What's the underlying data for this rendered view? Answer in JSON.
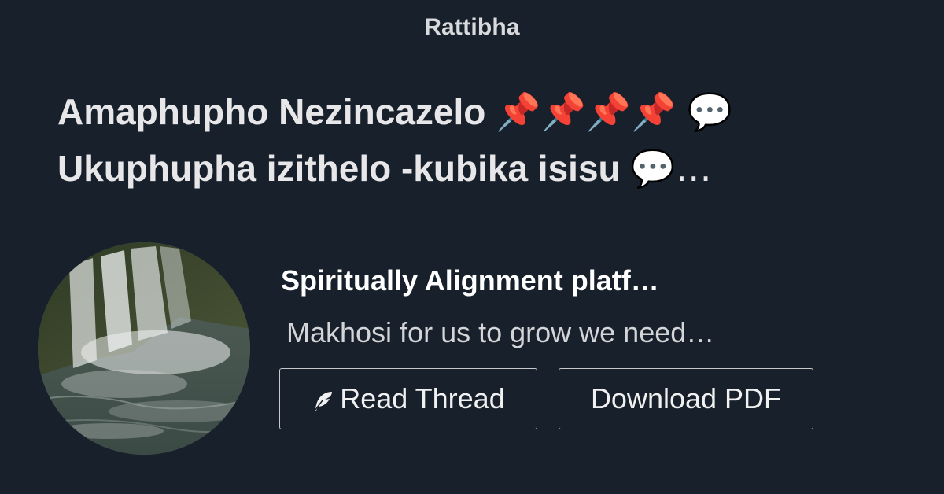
{
  "brand": {
    "name": "Rattibha"
  },
  "thread": {
    "title_line1_text": "Amaphupho Nezincazelo",
    "title_line1_emoji": "📌📌📌📌 💬",
    "title_line2_text": "Ukuphupha izithelo -kubika isisu",
    "title_line2_emoji": "💬…"
  },
  "author": {
    "name": "Spiritually Alignment platf…",
    "avatar_icon": "waterfall-photo"
  },
  "snippet": {
    "text": "Makhosi for us to grow we need…"
  },
  "actions": {
    "read_label": "Read Thread",
    "read_icon": "feather-icon",
    "pdf_label": "Download PDF"
  },
  "colors": {
    "background": "#18202b",
    "text": "#e7e7e9",
    "button_border": "#c7c9cc"
  }
}
